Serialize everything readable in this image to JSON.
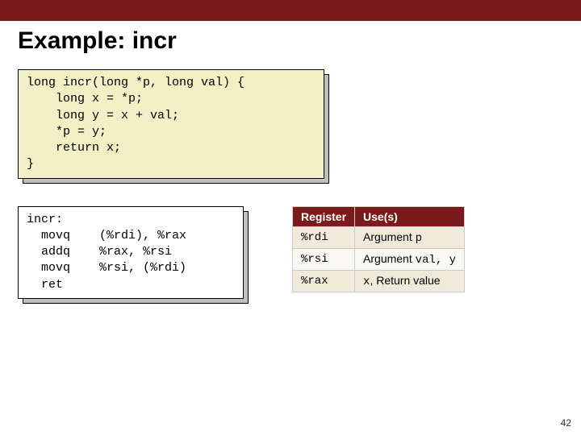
{
  "title": "Example: incr",
  "code_c": "long incr(long *p, long val) {\n    long x = *p;\n    long y = x + val;\n    *p = y;\n    return x;\n}",
  "code_asm": "incr:\n  movq    (%rdi), %rax\n  addq    %rax, %rsi\n  movq    %rsi, (%rdi)\n  ret",
  "table": {
    "headers": {
      "c0": "Register",
      "c1": "Use(s)"
    },
    "rows": [
      {
        "reg": "%rdi",
        "use_pre": "Argument ",
        "use_code": "p",
        "use_post": ""
      },
      {
        "reg": "%rsi",
        "use_pre": "Argument ",
        "use_code": "val",
        "use_post": ", y"
      },
      {
        "reg": "%rax",
        "use_pre": "",
        "use_code": "x",
        "use_post": ", Return value"
      }
    ]
  },
  "page_number": "42"
}
